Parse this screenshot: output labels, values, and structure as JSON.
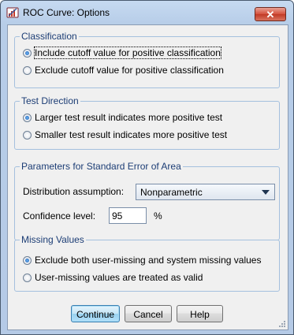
{
  "window": {
    "title": "ROC Curve: Options",
    "close_label": "✕"
  },
  "classification": {
    "legend": "Classification",
    "options": [
      {
        "label": "Include cutoff value for positive classification",
        "checked": true
      },
      {
        "label": "Exclude cutoff value for positive classification",
        "checked": false
      }
    ]
  },
  "test_direction": {
    "legend": "Test Direction",
    "options": [
      {
        "label": "Larger test result indicates more positive test",
        "checked": true
      },
      {
        "label": "Smaller test result indicates more positive test",
        "checked": false
      }
    ]
  },
  "parameters": {
    "legend": "Parameters for Standard Error of Area",
    "distribution_label": "Distribution assumption:",
    "distribution_value": "Nonparametric",
    "confidence_label": "Confidence level:",
    "confidence_value": "95",
    "confidence_unit": "%"
  },
  "missing_values": {
    "legend": "Missing Values",
    "options": [
      {
        "label": "Exclude both user-missing and system missing values",
        "checked": true
      },
      {
        "label": "User-missing values are treated as valid",
        "checked": false
      }
    ]
  },
  "buttons": {
    "continue": "Continue",
    "cancel": "Cancel",
    "help": "Help"
  },
  "colors": {
    "legend_text": "#1c3d75",
    "default_button": "#98d1ef",
    "close_button": "#d4503c"
  }
}
